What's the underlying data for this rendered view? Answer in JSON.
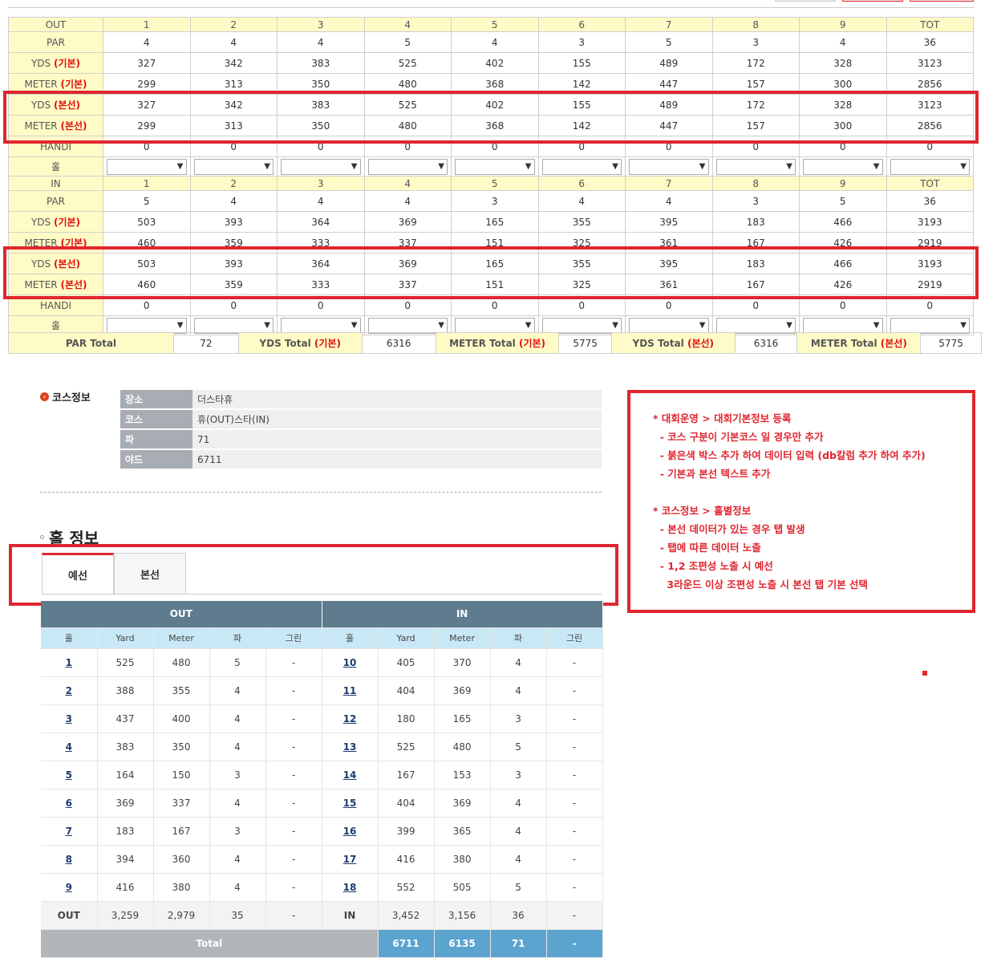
{
  "score": {
    "out_header": [
      "OUT",
      "1",
      "2",
      "3",
      "4",
      "5",
      "6",
      "7",
      "8",
      "9",
      "TOT"
    ],
    "in_header": [
      "IN",
      "1",
      "2",
      "3",
      "4",
      "5",
      "6",
      "7",
      "8",
      "9",
      "TOT"
    ],
    "out_rows": [
      {
        "label": "PAR",
        "tag": "",
        "values": [
          "4",
          "4",
          "4",
          "5",
          "4",
          "3",
          "5",
          "3",
          "4",
          "36"
        ]
      },
      {
        "label": "YDS",
        "tag": "(기본)",
        "values": [
          "327",
          "342",
          "383",
          "525",
          "402",
          "155",
          "489",
          "172",
          "328",
          "3123"
        ]
      },
      {
        "label": "METER",
        "tag": "(기본)",
        "values": [
          "299",
          "313",
          "350",
          "480",
          "368",
          "142",
          "447",
          "157",
          "300",
          "2856"
        ]
      },
      {
        "label": "YDS",
        "tag": "(본선)",
        "values": [
          "327",
          "342",
          "383",
          "525",
          "402",
          "155",
          "489",
          "172",
          "328",
          "3123"
        ]
      },
      {
        "label": "METER",
        "tag": "(본선)",
        "values": [
          "299",
          "313",
          "350",
          "480",
          "368",
          "142",
          "447",
          "157",
          "300",
          "2856"
        ]
      },
      {
        "label": "HANDI",
        "tag": "",
        "values": [
          "0",
          "0",
          "0",
          "0",
          "0",
          "0",
          "0",
          "0",
          "0",
          "0"
        ]
      }
    ],
    "in_rows": [
      {
        "label": "PAR",
        "tag": "",
        "values": [
          "5",
          "4",
          "4",
          "4",
          "3",
          "4",
          "4",
          "3",
          "5",
          "36"
        ]
      },
      {
        "label": "YDS",
        "tag": "(기본)",
        "values": [
          "503",
          "393",
          "364",
          "369",
          "165",
          "355",
          "395",
          "183",
          "466",
          "3193"
        ]
      },
      {
        "label": "METER",
        "tag": "(기본)",
        "values": [
          "460",
          "359",
          "333",
          "337",
          "151",
          "325",
          "361",
          "167",
          "426",
          "2919"
        ]
      },
      {
        "label": "YDS",
        "tag": "(본선)",
        "values": [
          "503",
          "393",
          "364",
          "369",
          "165",
          "355",
          "395",
          "183",
          "466",
          "3193"
        ]
      },
      {
        "label": "METER",
        "tag": "(본선)",
        "values": [
          "460",
          "359",
          "333",
          "337",
          "151",
          "325",
          "361",
          "167",
          "426",
          "2919"
        ]
      },
      {
        "label": "HANDI",
        "tag": "",
        "values": [
          "0",
          "0",
          "0",
          "0",
          "0",
          "0",
          "0",
          "0",
          "0",
          "0"
        ]
      }
    ],
    "hole_label": "홀",
    "dropdown_arrow": "▼"
  },
  "totals": {
    "par_label": "PAR Total",
    "par_value": "72",
    "yds_label": "YDS Total",
    "yds_tag": "(기본)",
    "yds_value": "6316",
    "meter_label": "METER Total",
    "meter_tag": "(기본)",
    "meter_value": "5775",
    "yds2_label": "YDS Total",
    "yds2_tag": "(본선)",
    "yds2_value": "6316",
    "meter2_label": "METER Total",
    "meter2_tag": "(본선)",
    "meter2_value": "5775"
  },
  "course_info": {
    "title": "코스정보",
    "rows": [
      {
        "k": "장소",
        "v": "더스타휴"
      },
      {
        "k": "코스",
        "v": "휴(OUT)스타(IN)"
      },
      {
        "k": "파",
        "v": "71"
      },
      {
        "k": "야드",
        "v": "6711"
      }
    ]
  },
  "hole_info": {
    "title": "홀 정보",
    "tabs": [
      "예선",
      "본선"
    ],
    "out_label": "OUT",
    "in_label": "IN",
    "columns": [
      "홀",
      "Yard",
      "Meter",
      "파",
      "그린",
      "홀",
      "Yard",
      "Meter",
      "파",
      "그린"
    ],
    "rows": [
      [
        "1",
        "525",
        "480",
        "5",
        "-",
        "10",
        "405",
        "370",
        "4",
        "-"
      ],
      [
        "2",
        "388",
        "355",
        "4",
        "-",
        "11",
        "404",
        "369",
        "4",
        "-"
      ],
      [
        "3",
        "437",
        "400",
        "4",
        "-",
        "12",
        "180",
        "165",
        "3",
        "-"
      ],
      [
        "4",
        "383",
        "350",
        "4",
        "-",
        "13",
        "525",
        "480",
        "5",
        "-"
      ],
      [
        "5",
        "164",
        "150",
        "3",
        "-",
        "14",
        "167",
        "153",
        "3",
        "-"
      ],
      [
        "6",
        "369",
        "337",
        "4",
        "-",
        "15",
        "404",
        "369",
        "4",
        "-"
      ],
      [
        "7",
        "183",
        "167",
        "3",
        "-",
        "16",
        "399",
        "365",
        "4",
        "-"
      ],
      [
        "8",
        "394",
        "360",
        "4",
        "-",
        "17",
        "416",
        "380",
        "4",
        "-"
      ],
      [
        "9",
        "416",
        "380",
        "4",
        "-",
        "18",
        "552",
        "505",
        "5",
        "-"
      ]
    ],
    "subtotal": [
      "OUT",
      "3,259",
      "2,979",
      "35",
      "-",
      "IN",
      "3,452",
      "3,156",
      "36",
      "-"
    ],
    "total": {
      "label": "Total",
      "yard": "6711",
      "meter": "6135",
      "par": "71",
      "green": "-"
    }
  },
  "notes": [
    "* 대회운영 > 대회기본정보 등록",
    "  - 코스 구분이 기본코스 일 경우만 추가",
    "  - 붉은색 박스 추가 하여 데이터 입력 (db칼럼 추가 하여 추가)",
    "  - 기본과 본선 텍스트 추가",
    "",
    "* 코스정보 > 홀별정보",
    "  - 본선 데이터가 있는 경우 탭 발생",
    "  - 탭에 따른 데이터 노출",
    "  - 1,2 조편성 노출 시 예선",
    "    3라운드 이상 조편성 노출 시 본선 탭 기본 선택"
  ],
  "colors": {
    "accent_red": "#e0262f",
    "header_yellow": "#fffbc6",
    "table_head": "#5f7b8e",
    "sub_head": "#c9e8f6",
    "total_blue": "#5ba4cf"
  }
}
